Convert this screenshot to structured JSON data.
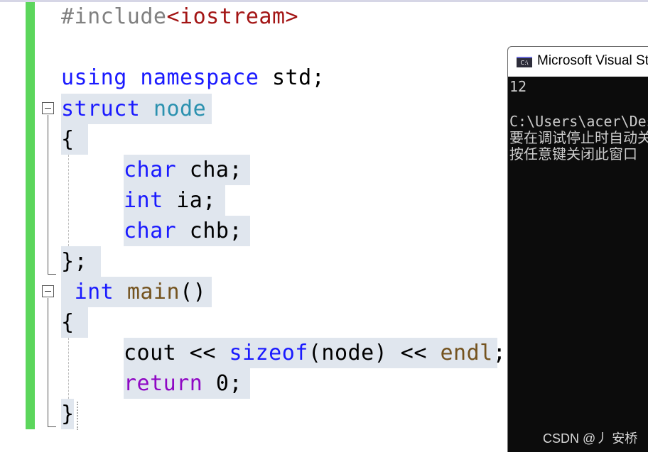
{
  "editor": {
    "include": {
      "directive": "#include",
      "header": "<iostream>"
    },
    "using": {
      "kw1": "using",
      "kw2": "namespace",
      "rest": " std;"
    },
    "struct": {
      "kw": "struct",
      "name": "node"
    },
    "brace_open": "{",
    "member1": {
      "type": "char",
      "rest": " cha;"
    },
    "member2": {
      "type": "int",
      "rest": " ia;"
    },
    "member3": {
      "type": "char",
      "rest": " chb;"
    },
    "struct_end": "};",
    "main_decl": {
      "type": "int",
      "name": "main",
      "rest": "()"
    },
    "main_brace_open": "{",
    "cout_line": {
      "cout": "cout << ",
      "sizeof": "sizeof",
      "args": "(node) << ",
      "endl": "endl",
      "end": ";"
    },
    "return_line": {
      "kw": "return",
      "rest": " 0;"
    },
    "main_brace_close": "}"
  },
  "console": {
    "title": "Microsoft Visual Studio Debug Console",
    "icon_label": "C:\\",
    "output": [
      "12",
      "C:\\Users\\acer\\Desktop",
      "要在调试停止时自动关闭控制台",
      "按任意键关闭此窗口"
    ]
  },
  "watermark": "CSDN @丿 安桥",
  "colors": {
    "keyword": "#1a1aff",
    "type": "#2b91af",
    "function": "#74531f",
    "string": "#a31515",
    "control": "#8f08c4",
    "selection": "#e0e6ee",
    "change_bar": "#5cd65c",
    "console_bg": "#0c0c0c"
  }
}
